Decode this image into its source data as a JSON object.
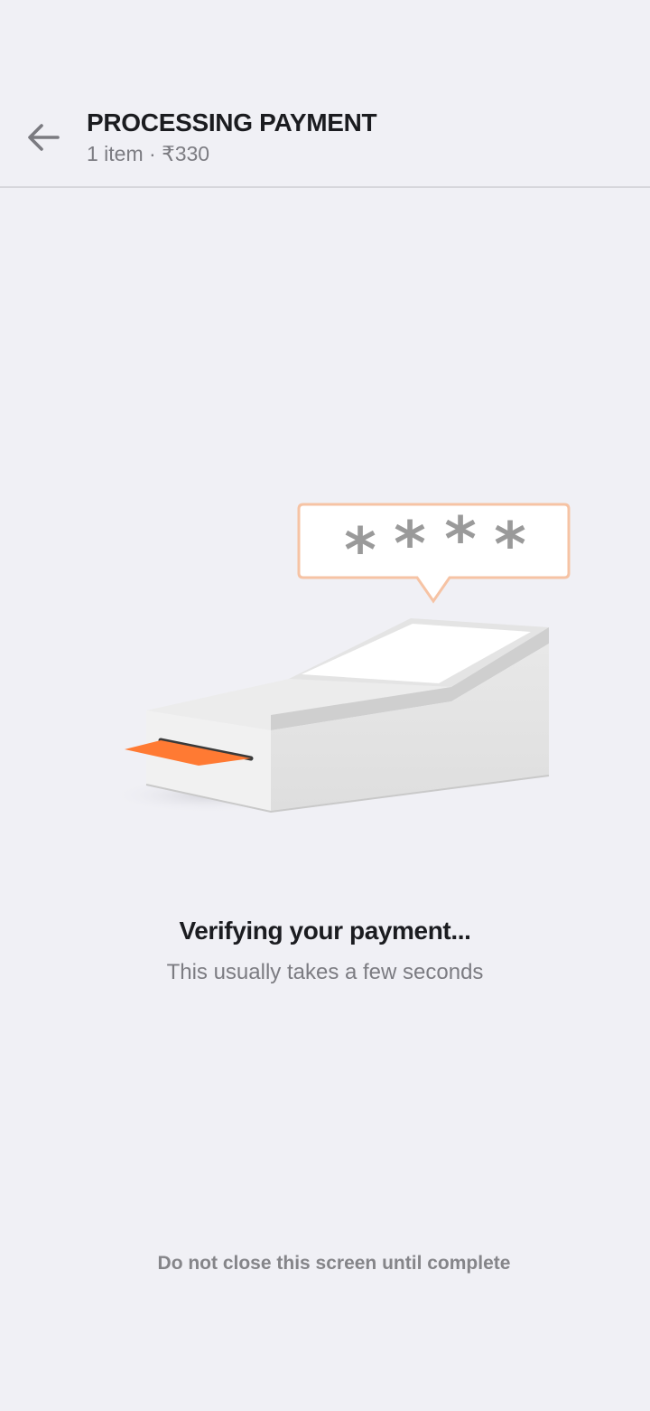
{
  "header": {
    "title": "PROCESSING PAYMENT",
    "subtitle": "1 item · ₹330",
    "back_icon": "arrow-left-icon"
  },
  "illustration": {
    "pin_mask": "****",
    "accent_color": "#ff7a33",
    "bubble_border_color": "#f6c3a4"
  },
  "status": {
    "title": "Verifying your payment...",
    "subtitle": "This usually takes a few seconds"
  },
  "footer": {
    "warning": "Do not close this screen until complete"
  }
}
